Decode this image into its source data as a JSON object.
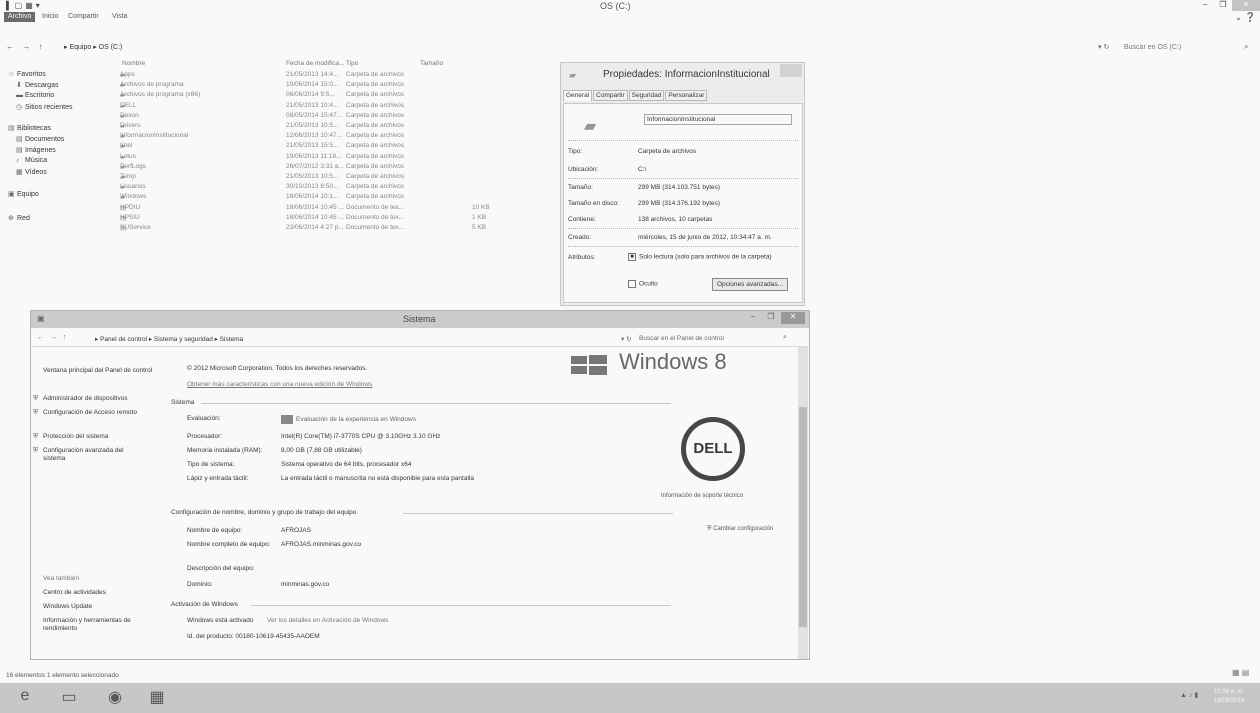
{
  "explorer": {
    "title": "OS (C:)",
    "qat": [
      "▌",
      "▢",
      "▦",
      "▾"
    ],
    "tabs": [
      "Archivo",
      "Inicio",
      "Compartir",
      "Vista"
    ],
    "nav_arrows": "← → ↑",
    "breadcrumb": "▸ Equipo ▸ OS (C:)",
    "refresh": "▾ ↻",
    "search_placeholder": "Buscar en OS (C:)",
    "columns": {
      "name": "Nombre",
      "date": "Fecha de modifica...",
      "type": "Tipo",
      "size": "Tamaño"
    },
    "nav": [
      {
        "label": "Favoritos",
        "icon": "☆"
      },
      {
        "label": "Descargas",
        "icon": "⬇"
      },
      {
        "label": "Escritorio",
        "icon": "▬"
      },
      {
        "label": "Sitios recientes",
        "icon": "◷"
      },
      {
        "label": "Bibliotecas",
        "icon": "▤"
      },
      {
        "label": "Documentos",
        "icon": "▤"
      },
      {
        "label": "Imágenes",
        "icon": "▤"
      },
      {
        "label": "Música",
        "icon": "♪"
      },
      {
        "label": "Vídeos",
        "icon": "▦"
      },
      {
        "label": "Equipo",
        "icon": "▣"
      },
      {
        "label": "Red",
        "icon": "⊕"
      }
    ],
    "files": [
      {
        "name": "Apps",
        "date": "21/05/2013 14:4...",
        "type": "Carpeta de archivos",
        "size": ""
      },
      {
        "name": "Archivos de programa",
        "date": "10/06/2014 15:0...",
        "type": "Carpeta de archivos",
        "size": ""
      },
      {
        "name": "Archivos de programa (x86)",
        "date": "06/06/2014 9:5...",
        "type": "Carpeta de archivos",
        "size": ""
      },
      {
        "name": "DELL",
        "date": "21/05/2013 10:4...",
        "type": "Carpeta de archivos",
        "size": ""
      },
      {
        "name": "Dexon",
        "date": "08/05/2014 15:47...",
        "type": "Carpeta de archivos",
        "size": ""
      },
      {
        "name": "Drivers",
        "date": "21/05/2013 10:5...",
        "type": "Carpeta de archivos",
        "size": ""
      },
      {
        "name": "InformacionInstitucional",
        "date": "12/06/2013 10:47...",
        "type": "Carpeta de archivos",
        "size": ""
      },
      {
        "name": "Intel",
        "date": "21/05/2013 15:5...",
        "type": "Carpeta de archivos",
        "size": ""
      },
      {
        "name": "Lotus",
        "date": "19/06/2013 11:18...",
        "type": "Carpeta de archivos",
        "size": ""
      },
      {
        "name": "PerfLogs",
        "date": "26/07/2012 3:31 a...",
        "type": "Carpeta de archivos",
        "size": ""
      },
      {
        "name": "Temp",
        "date": "21/05/2013 10:5...",
        "type": "Carpeta de archivos",
        "size": ""
      },
      {
        "name": "Usuarios",
        "date": "30/10/2013 8:50...",
        "type": "Carpeta de archivos",
        "size": ""
      },
      {
        "name": "Windows",
        "date": "18/06/2014 10:1...",
        "type": "Carpeta de archivos",
        "size": ""
      },
      {
        "name": "HPDIU",
        "date": "18/06/2014 10:45 ...",
        "type": "Documento de tex...",
        "size": "10 KB"
      },
      {
        "name": "HPSIU",
        "date": "18/06/2014 10:45 ...",
        "type": "Documento de tex...",
        "size": "1 KB"
      },
      {
        "name": "SUService",
        "date": "23/06/2014 4:27 p...",
        "type": "Documento de tex...",
        "size": "5 KB"
      }
    ],
    "status": "16 elementos    1 elemento seleccionado",
    "view_icons": "▦ ▤"
  },
  "properties": {
    "title": "Propiedades: InformacionInstitucional",
    "tabs": [
      "General",
      "Compartir",
      "Seguridad",
      "Personalizar"
    ],
    "folder_name": "InformacionInstitucional",
    "rows": [
      {
        "label": "Tipo:",
        "value": "Carpeta de archivos"
      },
      {
        "label": "Ubicación:",
        "value": "C:\\"
      },
      {
        "label": "Tamaño:",
        "value": "299 MB (314.103.751 bytes)"
      },
      {
        "label": "Tamaño en disco:",
        "value": "299 MB (314.376.192 bytes)"
      },
      {
        "label": "Contiene:",
        "value": "138 archivos, 10 carpetas"
      },
      {
        "label": "Creado:",
        "value": "miércoles, 15 de junio de 2012, 10:34:47 a. m."
      }
    ],
    "attributes_label": "Atributos:",
    "readonly_label": "Solo lectura (solo para archivos de la carpeta)",
    "hidden_label": "Oculto",
    "advanced_button": "Opciones avanzadas..."
  },
  "system": {
    "title": "Sistema",
    "breadcrumb": "▸ Panel de control ▸ Sistema y seguridad ▸ Sistema",
    "search_placeholder": "Buscar en el Panel de control",
    "left_top": "Ventana principal del Panel de control",
    "left_links": [
      "Administrador de dispositivos",
      "Configuración de Acceso remoto",
      "Protección del sistema",
      "Configuración avanzada del sistema"
    ],
    "see_also": "Vea también",
    "see_also_links": [
      "Centro de actividades",
      "Windows Update",
      "Información y herramientas de rendimiento"
    ],
    "copyright": "© 2012 Microsoft Corporation. Todos los dereches reservados.",
    "get_features": "Obtener más características con una nueva edición de Windows",
    "system_section": "Sistema",
    "system_rows": [
      {
        "key": "Evaluación:",
        "value": "Evaluación de la experiencia en Windows"
      },
      {
        "key": "Procesador:",
        "value": "Intel(R) Core(TM) i7-3770S CPU @ 3.10GHz   3.10 GHz"
      },
      {
        "key": "Memoria instalada (RAM):",
        "value": "8,00 GB (7,88 GB utilizable)"
      },
      {
        "key": "Tipo de sistema:",
        "value": "Sistema operativo de 64 bits, procesador x64"
      },
      {
        "key": "Lápiz y entrada táctil:",
        "value": "La entrada táctil o manuscrita no está disponible para esta pantalla"
      }
    ],
    "computer_section": "Configuración de nombre, dominio y grupo de trabajo del equipo",
    "computer_rows": [
      {
        "key": "Nombre de equipo:",
        "value": "AFROJAS"
      },
      {
        "key": "Nombre completo de equipo:",
        "value": "AFROJAS.minminas.gov.co"
      },
      {
        "key": "Descripción del equipo:",
        "value": ""
      },
      {
        "key": "Dominio:",
        "value": "minminas.gov.co"
      }
    ],
    "change_settings": "Cambiar configuración",
    "activation_section": "Activación de Windows",
    "activation_status": "Windows está activado",
    "activation_link": "Ver los detalles en Activación de Windows",
    "product_id": "Id. del producto: 00180-10619-45435-AAOEM",
    "windows_logo_text": "Windows 8",
    "dell_logo": "DELL",
    "support_info": "Información de soporte técnico"
  },
  "taskbar": {
    "apps": [
      "e",
      "▭",
      "◉",
      "▦"
    ],
    "tray": "▲ ♪ ▮",
    "clock_time": "10:09 a. m.",
    "clock_date": "18/06/2014"
  },
  "colors": {
    "accent": "#6a6a6a",
    "window_title_bg": "#cfcfcf",
    "taskbar": "#cbcbcb"
  }
}
